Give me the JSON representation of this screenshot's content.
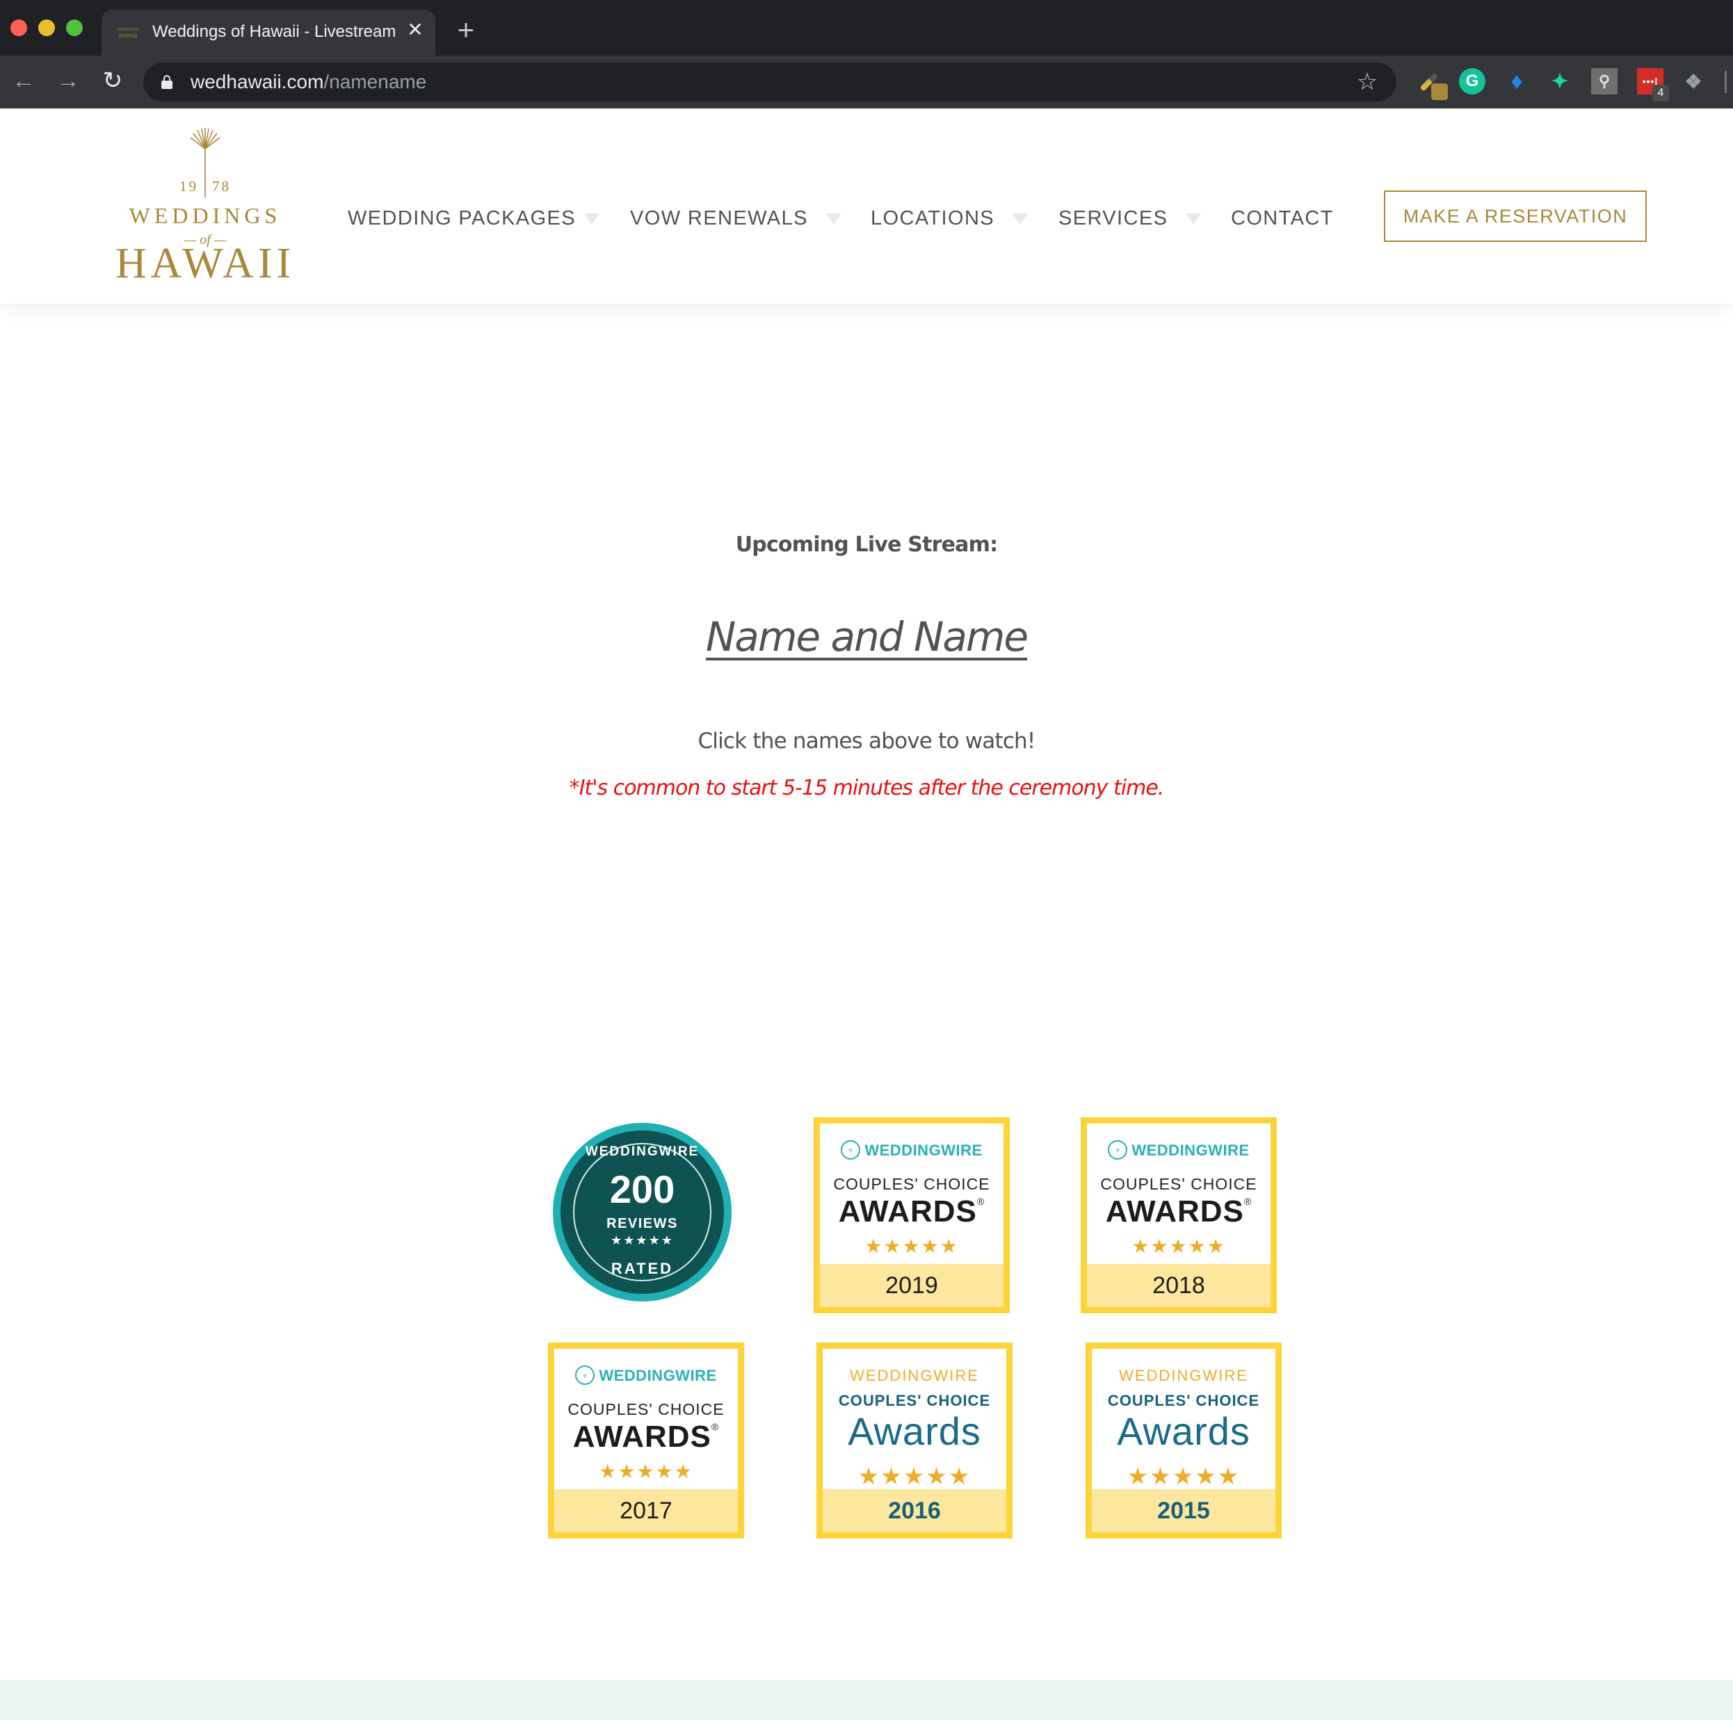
{
  "browser": {
    "tab": {
      "title": "Weddings of Hawaii - Livestream",
      "favicon_top": "WEDDINGS",
      "favicon_bottom": "HAWAII",
      "close_glyph": "✕"
    },
    "new_tab_glyph": "+",
    "nav": {
      "back_glyph": "←",
      "forward_glyph": "→",
      "reload_glyph": "↻"
    },
    "url": {
      "host": "wedhawaii.com",
      "path": "/namename"
    },
    "star_glyph": "☆",
    "extensions": [
      {
        "name": "color-picker",
        "glyph": ""
      },
      {
        "name": "grammarly",
        "glyph": "G"
      },
      {
        "name": "gem",
        "glyph": "♦"
      },
      {
        "name": "ninja",
        "glyph": "✦"
      },
      {
        "name": "hubspot",
        "glyph": "⚲"
      },
      {
        "name": "lastpass",
        "glyph": "•••|",
        "badge": "4"
      },
      {
        "name": "dropbox",
        "glyph": "❖"
      }
    ]
  },
  "site": {
    "logo": {
      "year_left": "19",
      "year_right": "78",
      "weddings": "WEDDINGS",
      "of": "— of —",
      "hawaii": "HAWAII"
    },
    "nav": [
      {
        "label": "WEDDING PACKAGES",
        "has_dropdown": true
      },
      {
        "label": "VOW RENEWALS",
        "has_dropdown": true
      },
      {
        "label": "LOCATIONS",
        "has_dropdown": true
      },
      {
        "label": "SERVICES",
        "has_dropdown": true
      },
      {
        "label": "CONTACT",
        "has_dropdown": false
      }
    ],
    "cta": "MAKE A RESERVATION",
    "colors": {
      "gold": "#a8883a",
      "text": "#55524d",
      "note_red": "#e81010",
      "footer_bg": "#ebf4f0"
    }
  },
  "content": {
    "heading": "Upcoming Live Stream:",
    "names_link": "Name and Name",
    "instruction": "Click the names above to watch!",
    "note": "*It's common to start 5-15 minutes after the ceremony time."
  },
  "badges": {
    "reviews": {
      "brand": "WEDDINGWIRE",
      "count": "200",
      "label": "REVIEWS",
      "stars": "★★★★★",
      "rated": "RATED"
    },
    "awards": [
      {
        "brand": "WEDDINGWIRE",
        "line1": "COUPLES' CHOICE",
        "line2": "AWARDS",
        "reg": "®",
        "stars": "★★★★★",
        "year": "2019",
        "style": "modern"
      },
      {
        "brand": "WEDDINGWIRE",
        "line1": "COUPLES' CHOICE",
        "line2": "AWARDS",
        "reg": "®",
        "stars": "★★★★★",
        "year": "2018",
        "style": "modern"
      },
      {
        "brand": "WEDDINGWIRE",
        "line1": "COUPLES' CHOICE",
        "line2": "AWARDS",
        "reg": "®",
        "stars": "★★★★★",
        "year": "2017",
        "style": "modern"
      },
      {
        "brand": "WEDDINGWIRE",
        "line1": "COUPLES' CHOICE",
        "line2": "Awards",
        "reg": "",
        "stars": "★★★★★",
        "year": "2016",
        "style": "classic"
      },
      {
        "brand": "WEDDINGWIRE",
        "line1": "COUPLES' CHOICE",
        "line2": "Awards",
        "reg": "",
        "stars": "★★★★★",
        "year": "2015",
        "style": "classic"
      }
    ]
  }
}
